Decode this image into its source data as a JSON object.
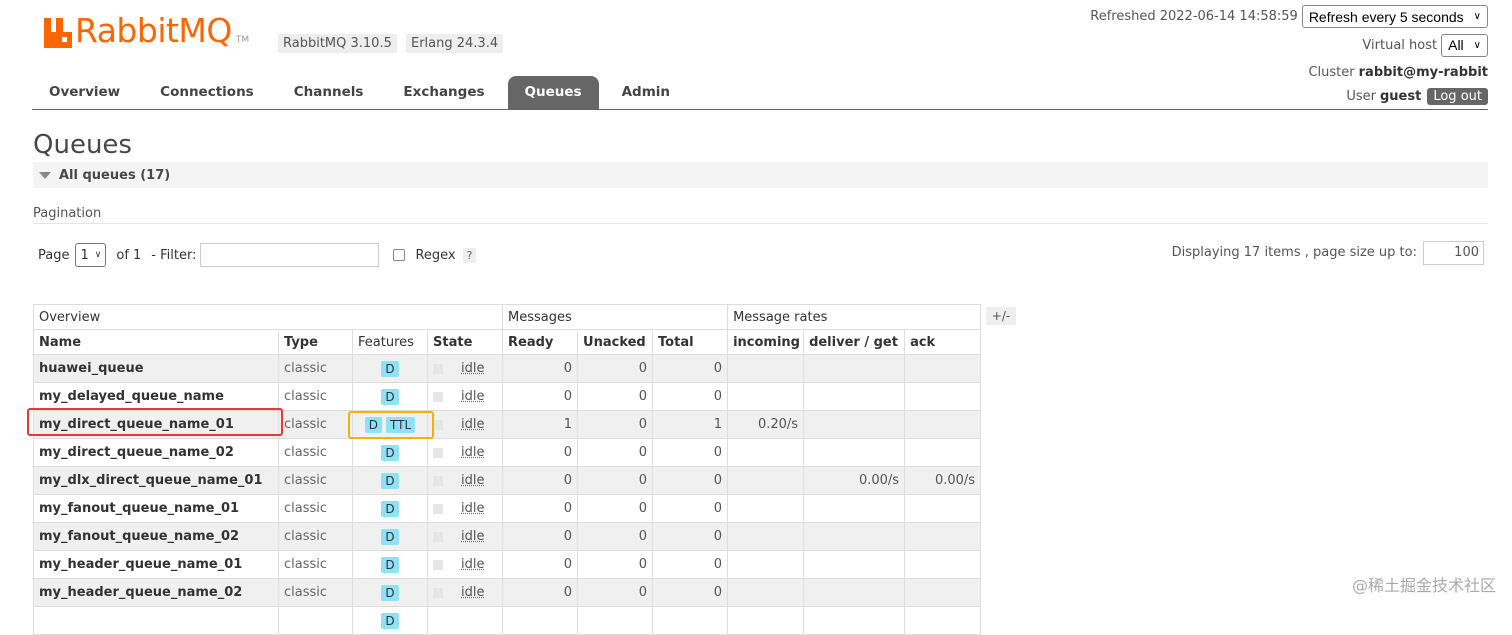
{
  "header": {
    "logo_text": "RabbitMQ",
    "logo_tm": "TM",
    "rabbitmq_version": "RabbitMQ 3.10.5",
    "erlang_version": "Erlang 24.3.4",
    "refreshed_text": "Refreshed 2022-06-14 14:58:59",
    "refresh_select": "Refresh every 5 seconds",
    "virtual_host_label": "Virtual host",
    "virtual_host_value": "All",
    "cluster_label": "Cluster",
    "cluster_value": "rabbit@my-rabbit",
    "user_label": "User",
    "user_value": "guest",
    "logout_label": "Log out"
  },
  "nav": {
    "items": [
      {
        "label": "Overview"
      },
      {
        "label": "Connections"
      },
      {
        "label": "Channels"
      },
      {
        "label": "Exchanges"
      },
      {
        "label": "Queues"
      },
      {
        "label": "Admin"
      }
    ],
    "active": "Queues"
  },
  "page": {
    "title": "Queues",
    "section_title": "All queues (17)",
    "pagination_label": "Pagination",
    "page_label": "Page",
    "page_value": "1",
    "of_label": "of 1",
    "filter_label": "- Filter:",
    "filter_value": "",
    "regex_label": "Regex",
    "help_label": "?",
    "display_info": "Displaying 17 items , page size up to:",
    "page_size": "100"
  },
  "table": {
    "groups": [
      "Overview",
      "Messages",
      "Message rates"
    ],
    "plus_minus": "+/-",
    "columns": [
      "Name",
      "Type",
      "Features",
      "State",
      "Ready",
      "Unacked",
      "Total",
      "incoming",
      "deliver / get",
      "ack"
    ],
    "rows": [
      {
        "name": "huawei_queue",
        "type": "classic",
        "features": [
          "D"
        ],
        "state": "idle",
        "ready": "0",
        "unacked": "0",
        "total": "0",
        "incoming": "",
        "deliver_get": "",
        "ack": ""
      },
      {
        "name": "my_delayed_queue_name",
        "type": "classic",
        "features": [
          "D"
        ],
        "state": "idle",
        "ready": "0",
        "unacked": "0",
        "total": "0",
        "incoming": "",
        "deliver_get": "",
        "ack": ""
      },
      {
        "name": "my_direct_queue_name_01",
        "type": "classic",
        "features": [
          "D",
          "TTL"
        ],
        "state": "idle",
        "ready": "1",
        "unacked": "0",
        "total": "1",
        "incoming": "0.20/s",
        "deliver_get": "",
        "ack": ""
      },
      {
        "name": "my_direct_queue_name_02",
        "type": "classic",
        "features": [
          "D"
        ],
        "state": "idle",
        "ready": "0",
        "unacked": "0",
        "total": "0",
        "incoming": "",
        "deliver_get": "",
        "ack": ""
      },
      {
        "name": "my_dlx_direct_queue_name_01",
        "type": "classic",
        "features": [
          "D"
        ],
        "state": "idle",
        "ready": "0",
        "unacked": "0",
        "total": "0",
        "incoming": "",
        "deliver_get": "0.00/s",
        "ack": "0.00/s"
      },
      {
        "name": "my_fanout_queue_name_01",
        "type": "classic",
        "features": [
          "D"
        ],
        "state": "idle",
        "ready": "0",
        "unacked": "0",
        "total": "0",
        "incoming": "",
        "deliver_get": "",
        "ack": ""
      },
      {
        "name": "my_fanout_queue_name_02",
        "type": "classic",
        "features": [
          "D"
        ],
        "state": "idle",
        "ready": "0",
        "unacked": "0",
        "total": "0",
        "incoming": "",
        "deliver_get": "",
        "ack": ""
      },
      {
        "name": "my_header_queue_name_01",
        "type": "classic",
        "features": [
          "D"
        ],
        "state": "idle",
        "ready": "0",
        "unacked": "0",
        "total": "0",
        "incoming": "",
        "deliver_get": "",
        "ack": ""
      },
      {
        "name": "my_header_queue_name_02",
        "type": "classic",
        "features": [
          "D"
        ],
        "state": "idle",
        "ready": "0",
        "unacked": "0",
        "total": "0",
        "incoming": "",
        "deliver_get": "",
        "ack": ""
      },
      {
        "name": "",
        "type": "",
        "features": [
          "D"
        ],
        "state": "",
        "ready": "",
        "unacked": "",
        "total": "",
        "incoming": "",
        "deliver_get": "",
        "ack": ""
      }
    ]
  },
  "watermark": "@稀土掘金技术社区",
  "colors": {
    "brand": "#ff6600",
    "nav_active": "#666666",
    "feature_badge": "#8de2f5",
    "highlight_red": "#e53935",
    "highlight_orange": "#f6b100"
  }
}
